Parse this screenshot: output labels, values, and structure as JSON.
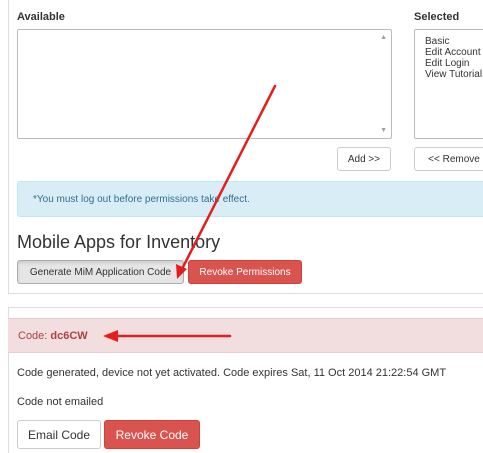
{
  "permissions": {
    "available_label": "Available",
    "selected_label": "Selected",
    "selected_items": [
      "Basic",
      "Edit Account",
      "Edit Login",
      "View Tutorial"
    ],
    "add_button": "Add >>",
    "remove_button": "<< Remove",
    "notice": "*You must log out before permissions take effect."
  },
  "mobile_apps": {
    "title": "Mobile Apps for Inventory",
    "generate_button": "Generate MiM Application Code",
    "revoke_permissions_button": "Revoke Permissions"
  },
  "code_panel": {
    "code_label": "Code:",
    "code_value": "dc6CW",
    "status_text": "Code generated, device not yet activated. Code expires Sat, 11 Oct 2014 21:22:54 GMT",
    "email_status": "Code not emailed",
    "email_button": "Email Code",
    "revoke_code_button": "Revoke Code"
  },
  "colors": {
    "annotation_arrow": "#e41e1e",
    "danger": "#d9534f",
    "info_bg": "#d9edf7",
    "alert_danger_bg": "#f2dede"
  },
  "icons": {
    "scroll_up": "triangle-up",
    "scroll_down": "triangle-down"
  }
}
